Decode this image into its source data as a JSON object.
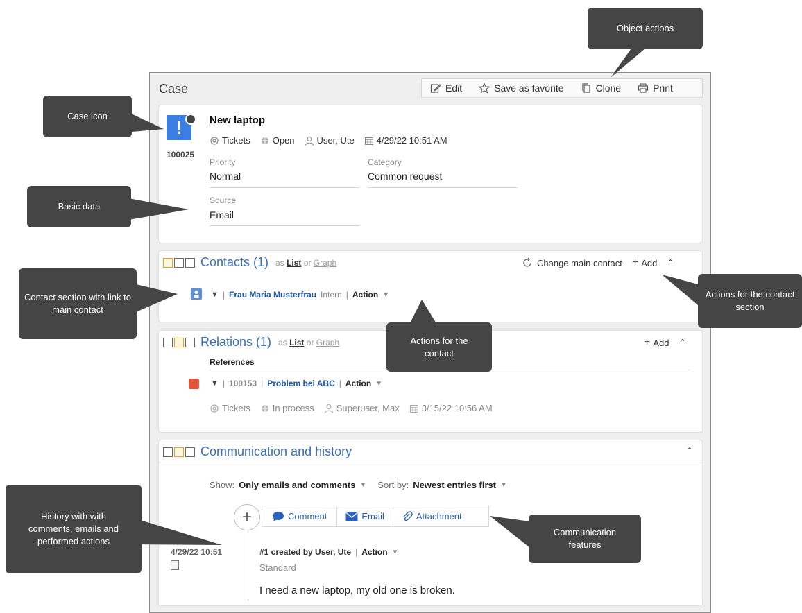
{
  "window": {
    "title": "Case",
    "toolbar": {
      "edit": "Edit",
      "favorite": "Save as favorite",
      "clone": "Clone",
      "print": "Print"
    }
  },
  "case": {
    "icon_symbol": "!",
    "number": "100025",
    "name": "New laptop",
    "meta": {
      "type": "Tickets",
      "status": "Open",
      "owner": "User, Ute",
      "date": "4/29/22 10:51 AM"
    },
    "fields": {
      "priority_label": "Priority",
      "priority_value": "Normal",
      "category_label": "Category",
      "category_value": "Common request",
      "source_label": "Source",
      "source_value": "Email"
    }
  },
  "contacts": {
    "title": "Contacts (1)",
    "as": "as",
    "list": "List",
    "or": "or",
    "graph": "Graph",
    "change_main": "Change main contact",
    "add": "Add",
    "row": {
      "name": "Frau Maria Musterfrau",
      "tag": "Intern",
      "action": "Action"
    }
  },
  "relations": {
    "title": "Relations (1)",
    "as": "as",
    "list": "List",
    "or": "or",
    "graph": "Graph",
    "add": "Add",
    "group": "References",
    "row": {
      "number": "100153",
      "name": "Problem bei ABC",
      "action": "Action",
      "type": "Tickets",
      "status": "In process",
      "owner": "Superuser, Max",
      "date": "3/15/22 10:56 AM"
    }
  },
  "communication": {
    "title": "Communication and history",
    "show_label": "Show:",
    "show_value": "Only emails and comments",
    "sort_label": "Sort by:",
    "sort_value": "Newest entries first",
    "buttons": {
      "comment": "Comment",
      "email": "Email",
      "attachment": "Attachment"
    },
    "entry": {
      "date": "4/29/22 10:51",
      "header": "#1 created by User, Ute",
      "action": "Action",
      "type": "Standard",
      "text": "I need a new laptop, my old one is broken."
    }
  },
  "callouts": {
    "object_actions": "Object actions",
    "case_icon": "Case icon",
    "basic_data": "Basic data",
    "contact_section": "Contact section with link to main contact",
    "contact_section_actions": "Actions for the contact section",
    "contact_actions": "Actions for the contact",
    "history": "History with with comments, emails and performed actions",
    "communication_features": "Communication features"
  },
  "colors": {
    "accent": "#3b6fb6",
    "case_icon": "#3b7de0",
    "callout": "#454545",
    "relation_icon": "#e0553a"
  }
}
